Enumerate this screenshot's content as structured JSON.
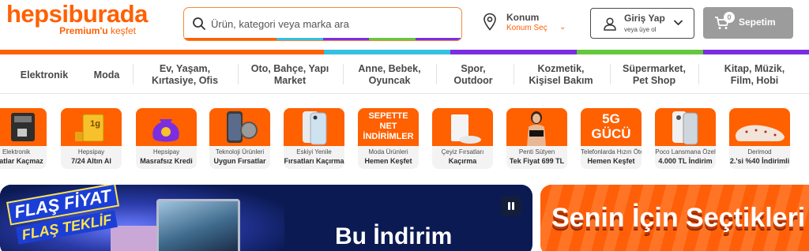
{
  "header": {
    "logo_main": "hepsiburada",
    "logo_sub_bold": "Premium'u",
    "logo_sub_rest": " keşfet",
    "search_placeholder": "Ürün, kategori veya marka ara",
    "location_title": "Konum",
    "location_sub": "Konum Seç",
    "account_title": "Giriş Yap",
    "account_sub": "veya üye ol",
    "cart_label": "Sepetim",
    "cart_count": "0"
  },
  "colors": {
    "brand": "#ff6000",
    "stripe": [
      "#ff6000",
      "#36bfe0",
      "#7b2ee0",
      "#64c83c",
      "#7b2ee0"
    ],
    "cart_bg": "#9c9c9c",
    "nav_text": "#484848"
  },
  "categories": [
    {
      "label": "Elektronik"
    },
    {
      "label": "Moda"
    },
    {
      "label": "Ev, Yaşam,\nKırtasiye, Ofis"
    },
    {
      "label": "Oto, Bahçe, Yapı\nMarket"
    },
    {
      "label": "Anne, Bebek,\nOyuncak"
    },
    {
      "label": "Spor,\nOutdoor"
    },
    {
      "label": "Kozmetik,\nKişisel Bakım"
    },
    {
      "label": "Süpermarket,\nPet Shop"
    },
    {
      "label": "Kitap, Müzik,\nFilm, Hobi"
    }
  ],
  "tiles": [
    {
      "caption": "Elektronik",
      "title": "Fiyatlar Kaçmaz",
      "icon": "coffee-machine-icon",
      "art": "machine"
    },
    {
      "caption": "Hepsipay",
      "title": "7/24 Altın Al",
      "icon": "gold-bar-icon",
      "art": "gold",
      "art_text": "1g"
    },
    {
      "caption": "Hepsipay",
      "title": "Masrafsız Kredi",
      "icon": "money-bag-icon",
      "art": "bag"
    },
    {
      "caption": "Teknoloji Ürünleri",
      "title": "Uygun Fırsatlar",
      "icon": "phone-watch-icon",
      "art": "phone-watch"
    },
    {
      "caption": "Eskiyi Yenile",
      "title": "Fırsatları Kaçırma",
      "icon": "smartphone-icon",
      "art": "phone"
    },
    {
      "caption": "Moda Ürünleri",
      "title": "Hemen Keşfet",
      "icon": "text-banner-icon",
      "art": "text",
      "art_text": "SEPETTE NET İNDİRİMLER"
    },
    {
      "caption": "Çeyiz Fırsatları",
      "title": "Kaçırma",
      "icon": "robot-vacuum-icon",
      "art": "vacuum"
    },
    {
      "caption": "Penti Sütyen",
      "title": "Tek Fiyat 699 TL",
      "icon": "model-photo-icon",
      "art": "model"
    },
    {
      "caption": "Telefonlarda Hızın Ötesi",
      "title": "Hemen Keşfet",
      "icon": "5g-icon",
      "art": "text5g",
      "art_text": "5G GÜCÜ"
    },
    {
      "caption": "Poco Lansmana Özel",
      "title": "4.000 TL İndirim",
      "icon": "smartphone-icon",
      "art": "poco"
    },
    {
      "caption": "Derimod",
      "title": "2.'si %40 İndirimli",
      "icon": "shoe-icon",
      "art": "shoe"
    }
  ],
  "banners": {
    "left_flash1": "FLAŞ FİYAT",
    "left_flash2": "FLAŞ TEKLİF",
    "left_title": "Bu İndirim",
    "right_title": "Senin İçin Seçtikleri"
  }
}
